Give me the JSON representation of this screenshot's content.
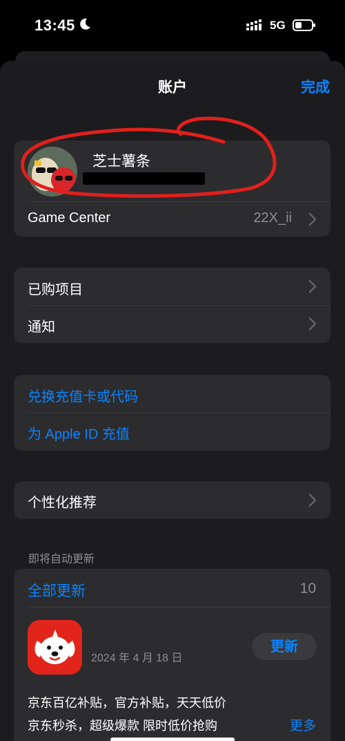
{
  "status_bar": {
    "time": "13:45",
    "network": "5G",
    "icons": [
      "moon-icon",
      "signal-icon",
      "battery-icon"
    ]
  },
  "nav": {
    "title": "账户",
    "done_label": "完成"
  },
  "profile": {
    "name": "芝士薯条",
    "avatar_icon": "avatar-photo"
  },
  "game_center": {
    "label": "Game Center",
    "value": "22X_ii"
  },
  "group1": {
    "items": [
      {
        "label": "已购项目"
      },
      {
        "label": "通知"
      }
    ]
  },
  "group2": {
    "items": [
      {
        "label": "兑换充值卡或代码"
      },
      {
        "label": "为 Apple ID 充值"
      }
    ]
  },
  "group3": {
    "items": [
      {
        "label": "个性化推荐"
      }
    ]
  },
  "updates": {
    "section_header": "即将自动更新",
    "update_all_label": "全部更新",
    "count": "10",
    "app": {
      "date": "2024 年 4 月 18 日",
      "update_label": "更新",
      "description_lines": [
        "京东百亿补贴，官方补贴，天天低价",
        "京东秒杀，超级爆款 限时低价抢购"
      ],
      "more_label": "更多"
    }
  },
  "colors": {
    "accent": "#0a84ff",
    "background": "#000000",
    "sheet": "#1c1c1e",
    "card": "#2c2c2e",
    "secondary_text": "#8e8e93",
    "annotation": "#e0201c",
    "app_icon": "#e1251b"
  }
}
